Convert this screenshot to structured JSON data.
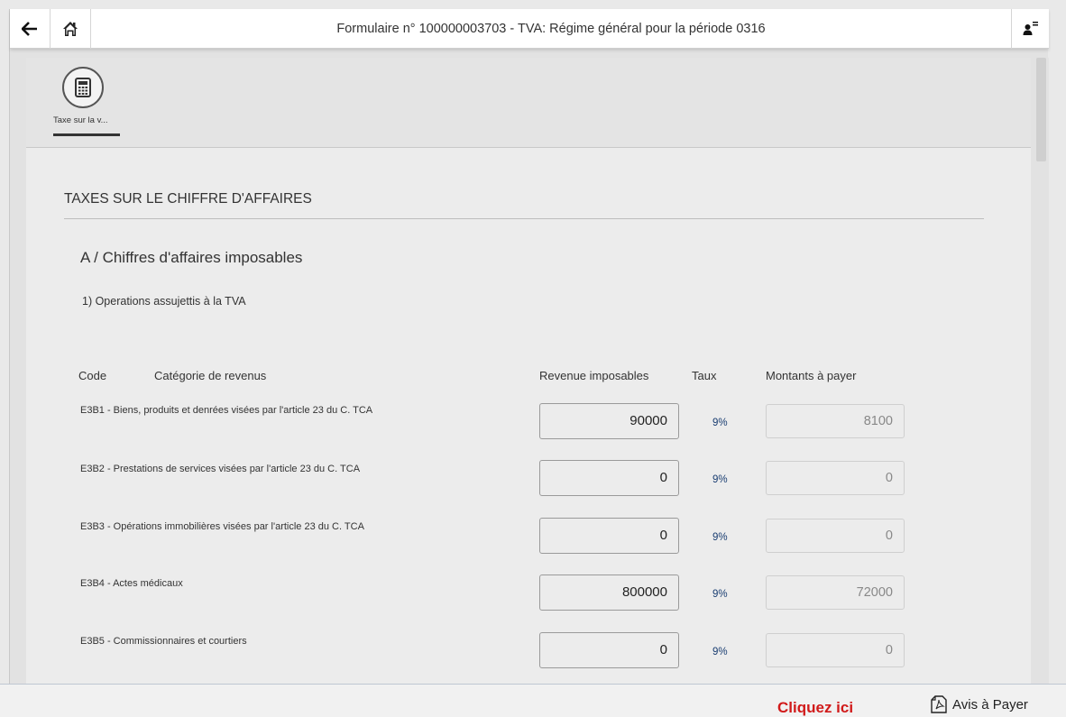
{
  "topbar": {
    "back_icon": "arrow-left-icon",
    "home_icon": "home-icon",
    "title": "Formulaire n° 100000003703 - TVA: Régime général pour la période 0316",
    "user_icon": "user-menu-icon"
  },
  "tabs": [
    {
      "label": "Taxe sur la v...",
      "icon": "calculator-icon",
      "active": true
    }
  ],
  "form": {
    "section_title": "TAXES SUR LE CHIFFRE D'AFFAIRES",
    "subsection_title": "A / Chiffres d'affaires imposables",
    "group_title": "1) Operations assujettis à la TVA",
    "columns": {
      "code": "Code",
      "category": "Catégorie de revenus",
      "taxable": "Revenue imposables",
      "rate": "Taux",
      "amount": "Montants à payer"
    },
    "rows": [
      {
        "label": "E3B1 - Biens, produits et denrées visées par l'article 23 du C. TCA",
        "taxable": "90000",
        "rate": "9%",
        "amount": "8100"
      },
      {
        "label": "E3B2 - Prestations de services visées par l'article 23 du C. TCA",
        "taxable": "0",
        "rate": "9%",
        "amount": "0"
      },
      {
        "label": "E3B3 - Opérations immobilières visées par l'article 23 du C. TCA",
        "taxable": "0",
        "rate": "9%",
        "amount": "0"
      },
      {
        "label": "E3B4 - Actes médicaux",
        "taxable": "800000",
        "rate": "9%",
        "amount": "72000"
      },
      {
        "label": "E3B5 - Commissionnaires et courtiers",
        "taxable": "0",
        "rate": "9%",
        "amount": "0"
      }
    ]
  },
  "footer": {
    "cta_text": "Cliquez ici",
    "pay_label": "Avis à Payer",
    "pay_icon": "pdf-document-icon",
    "accent_color": "#d11a1a"
  }
}
